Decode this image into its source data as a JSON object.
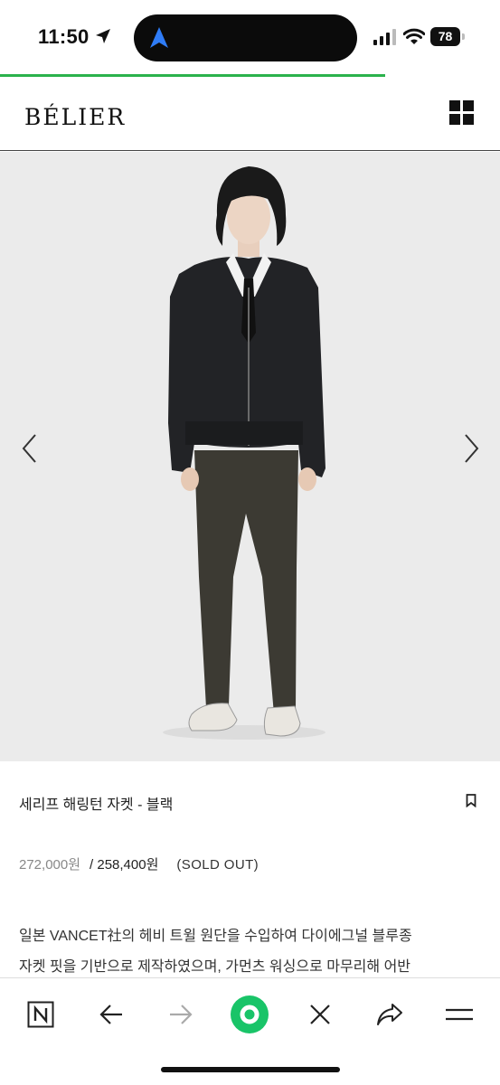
{
  "status_bar": {
    "time": "11:50",
    "battery": "78"
  },
  "page_load_progress": 0.77,
  "header": {
    "logo": "BÉLIER",
    "menu_icon": "grid-menu-icon"
  },
  "product": {
    "title": "세리프 해링턴 자켓 - 블랙",
    "price_original": "272,000원",
    "price_sale": "/ 258,400원",
    "status": "(SOLD OUT)",
    "description_lines": [
      "일본 VANCET社의 헤비 트윌 원단을 수입하여 다이에그널 블루종",
      "자켓 핏을 기반으로 제작하였으며, 가먼츠 워싱으로 마무리해 어반"
    ]
  },
  "gallery": {
    "prev_icon": "chevron-left-icon",
    "next_icon": "chevron-right-icon"
  },
  "toolbar": {
    "items": [
      "naver-icon",
      "back-icon",
      "forward-icon",
      "home-icon",
      "close-icon",
      "share-icon",
      "menu-icon"
    ]
  },
  "colors": {
    "accent_green": "#2bb24c",
    "toolbar_green": "#19c468",
    "image_bg": "#ebebeb"
  }
}
